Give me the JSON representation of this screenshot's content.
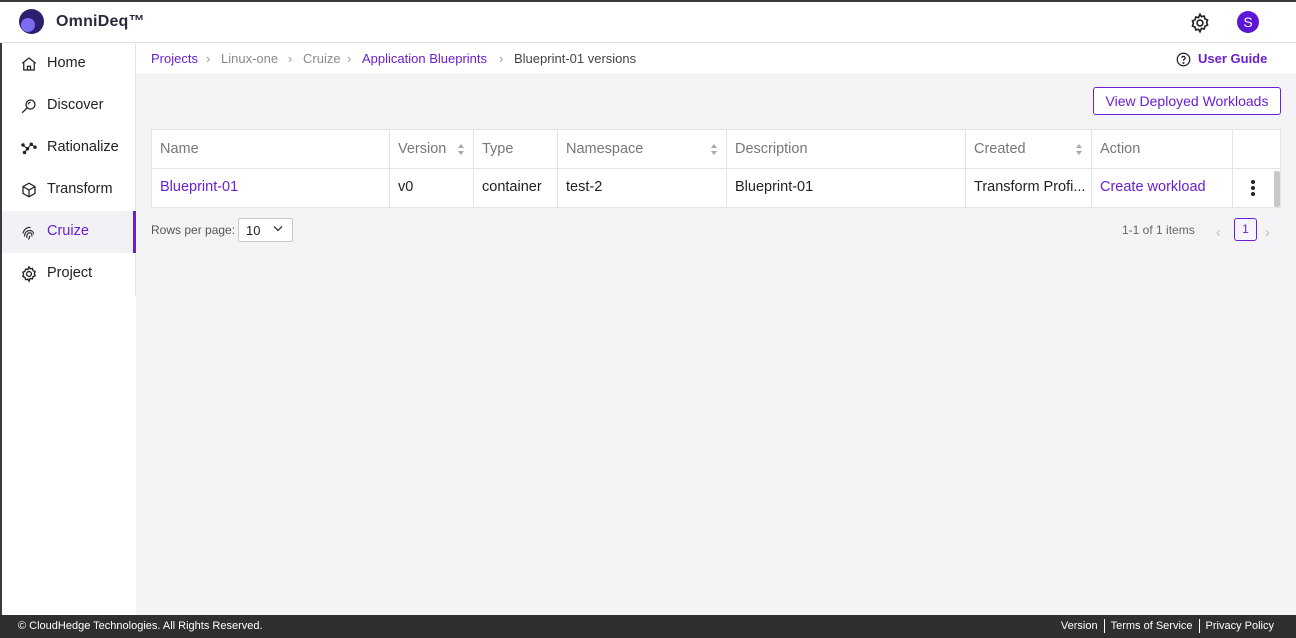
{
  "app": {
    "title": "OmniDeq™",
    "avatar_letter": "S",
    "accent": "#6a1fd0"
  },
  "sidebar": {
    "items": [
      {
        "label": "Home",
        "icon": "home-icon"
      },
      {
        "label": "Discover",
        "icon": "discover-icon"
      },
      {
        "label": "Rationalize",
        "icon": "rationalize-icon"
      },
      {
        "label": "Transform",
        "icon": "cube-icon"
      },
      {
        "label": "Cruize",
        "icon": "fingerprint-icon",
        "active": true
      },
      {
        "label": "Project",
        "icon": "gear-icon"
      }
    ]
  },
  "breadcrumb": {
    "items": [
      "Projects",
      "Linux-one",
      "Cruize",
      "Application Blueprints",
      "Blueprint-01 versions"
    ],
    "separator": "›"
  },
  "user_guide": {
    "label": "User Guide"
  },
  "actions": {
    "view_deployed": "View Deployed Workloads"
  },
  "table": {
    "columns": [
      "Name",
      "Version",
      "Type",
      "Namespace",
      "Description",
      "Created",
      "Action"
    ],
    "rows": [
      {
        "name": "Blueprint-01",
        "version": "v0",
        "type": "container",
        "namespace": "test-2",
        "description": "Blueprint-01",
        "created": "Transform Profi...",
        "action": "Create workload"
      }
    ]
  },
  "pagination": {
    "rows_per_page_label": "Rows per page:",
    "rows_per_page": "10",
    "range": "1-1 of 1 items",
    "current_page": "1",
    "prev": "‹",
    "next": "›"
  },
  "footer": {
    "copyright": "© CloudHedge Technologies. All Rights Reserved.",
    "links": [
      "Version",
      "Terms of Service",
      "Privacy Policy"
    ]
  }
}
